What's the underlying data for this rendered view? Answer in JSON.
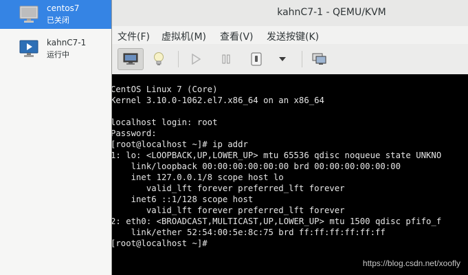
{
  "vm_list": [
    {
      "name": "centos7",
      "state": "已关闭",
      "selected": true
    },
    {
      "name": "kahnC7-1",
      "state": "运行中",
      "selected": false
    }
  ],
  "window": {
    "title": "kahnC7-1 - QEMU/KVM"
  },
  "menu": [
    "文件(F)",
    "虚拟机(M)",
    "查看(V)",
    "发送按键(K)"
  ],
  "toolbar": {
    "icons": [
      "monitor-icon",
      "lightbulb-icon",
      "play-icon",
      "pause-icon",
      "power-icon",
      "dropdown-arrow-icon",
      "snapshot-icon"
    ]
  },
  "console_lines": [
    "CentOS Linux 7 (Core)",
    "Kernel 3.10.0-1062.el7.x86_64 on an x86_64",
    "",
    "localhost login: root",
    "Password:",
    "[root@localhost ~]# ip addr",
    "1: lo: <LOOPBACK,UP,LOWER_UP> mtu 65536 qdisc noqueue state UNKNO",
    "    link/loopback 00:00:00:00:00:00 brd 00:00:00:00:00:00",
    "    inet 127.0.0.1/8 scope host lo",
    "       valid_lft forever preferred_lft forever",
    "    inet6 ::1/128 scope host",
    "       valid_lft forever preferred_lft forever",
    "2: eth0: <BROADCAST,MULTICAST,UP,LOWER_UP> mtu 1500 qdisc pfifo_f",
    "    link/ether 52:54:00:5e:8c:75 brd ff:ff:ff:ff:ff:ff",
    "[root@localhost ~]#"
  ],
  "watermark": "https://blog.csdn.net/xoofly",
  "colors": {
    "selection": "#3584e4",
    "console_bg": "#000000",
    "console_fg": "#e6e6e6"
  }
}
